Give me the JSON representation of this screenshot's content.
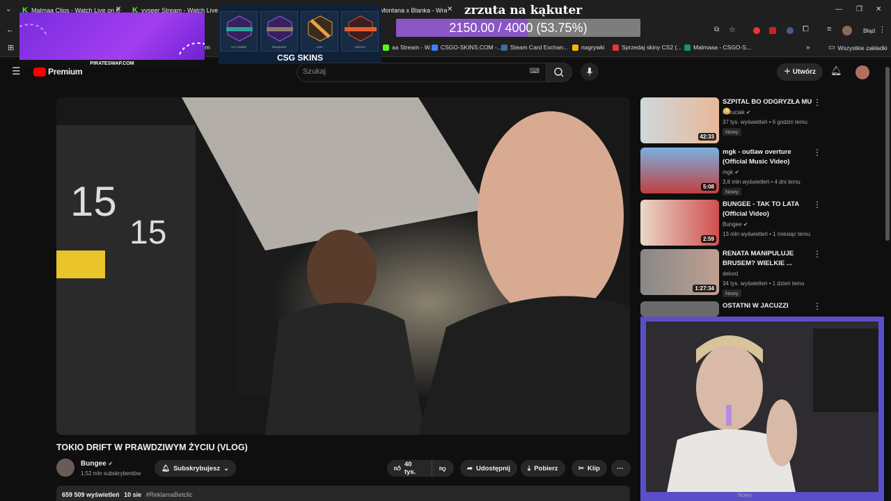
{
  "browser": {
    "tabs": [
      {
        "label": "Malmaa Clips - Watch Live on K",
        "icon": "kick-icon"
      },
      {
        "label": "vyseer Stream - Watch Live on",
        "icon": "kick-icon"
      },
      {
        "label": "Montana x Blanka - Wrac",
        "icon": "none"
      }
    ],
    "profile_label": "Błąd",
    "bookmarks": [
      {
        "label": "aa Stream - W...",
        "color": "#53fc18"
      },
      {
        "label": "CSGO-SKINS.COM -...",
        "color": "#3b82f6"
      },
      {
        "label": "Steam Card Exchan...",
        "color": "#1b2838"
      },
      {
        "label": "nagrywki",
        "color": "#f4b400"
      },
      {
        "label": "Sprzedaj skiny CS2 (...",
        "color": "#e33"
      },
      {
        "label": "Malmaaa - CSGO-S...",
        "color": "#0f9d58"
      }
    ],
    "bookmarks_folder": "Wszystkie zakładki",
    "partial_bookmark": "om"
  },
  "overlay": {
    "sponsor_label": "PIRATESWAP.COM",
    "csg_logo": "CSG SKINS",
    "skins": [
      "Ice Coaled",
      "Neoqueen",
      "Lore",
      "Asiimov"
    ],
    "goal_title": "zrzuta na kąkuter",
    "goal_text": "2150.00 / 4000 (53.75%)",
    "goal_fraction": 0.5375,
    "goal_color": "#8a56c4"
  },
  "youtube": {
    "logo_label": "Premium",
    "search_placeholder": "Szukaj",
    "create_label": "Utwórz",
    "video": {
      "title": "TOKIO DRIFT W PRAWDZIWYM ŻYCIU (VLOG)",
      "channel": "Bungee",
      "subscribers": "1,52 mln subskrybentów",
      "subscribed_label": "Subskrybujesz",
      "likes": "40 tys.",
      "share_label": "Udostępnij",
      "download_label": "Pobierz",
      "clip_label": "Klip",
      "views": "659 509 wyświetleń",
      "age": "10 sie",
      "hashtag": "#ReklamaBetclic"
    },
    "recommended": [
      {
        "title": "SZPITAL BO ODGRYZŁA MU 😳",
        "channel": "Naruciak",
        "meta": "37 tys. wyświetleń • 6 godzin temu",
        "duration": "42:33",
        "badge": "Nowy"
      },
      {
        "title": "mgk - outlaw overture (Official Music Video)",
        "channel": "mgk",
        "meta": "3,8 mln wyświetleń • 4 dni temu",
        "duration": "5:08",
        "badge": "Nowy"
      },
      {
        "title": "BUNGEE - TAK TO LATA (Official Video)",
        "channel": "Bungee",
        "meta": "13 mln wyświetleń • 1 miesiąc temu",
        "duration": "2:59",
        "badge": ""
      },
      {
        "title": "RENATA MANIPULUJE BRUSEM? WIELKIE ...",
        "channel": "delord",
        "meta": "34 tys. wyświetleń • 1 dzień temu",
        "duration": "1:27:34",
        "badge": "Nowy"
      },
      {
        "title": "OSTATNI W JACUZZI",
        "channel": "",
        "meta": "",
        "duration": "",
        "badge": ""
      }
    ],
    "bottom_badge": "Nowy"
  }
}
